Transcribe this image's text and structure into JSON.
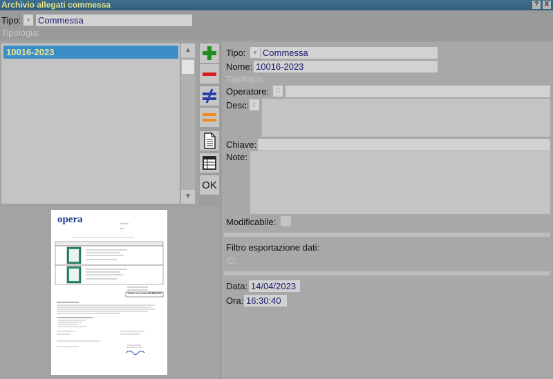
{
  "window": {
    "title": "Archivio allegati commessa",
    "help_label": "?",
    "close_label": "X"
  },
  "header": {
    "tipo_label": "Tipo:",
    "tipo_value": "Commessa",
    "tipologia_label": "Tipologia:"
  },
  "list": {
    "items": [
      {
        "label": "10016-2023",
        "selected": true
      }
    ]
  },
  "toolbar": {
    "add": "plus-icon",
    "remove": "minus-icon",
    "not_equal": "not-equal-icon",
    "equal": "equal-icon",
    "document": "document-icon",
    "table": "table-icon",
    "ok_label": "OK",
    "colors": {
      "add": "#1f8f1f",
      "remove": "#d62020",
      "not_equal": "#2a3fa8",
      "equal": "#f08a1a"
    }
  },
  "detail": {
    "tipo_label": "Tipo:",
    "tipo_value": "Commessa",
    "nome_label": "Nome:",
    "nome_value": "10016-2023",
    "tipologia_label": "Tipologia:",
    "operatore_label": "Operatore:",
    "operatore_btn": "C",
    "desc_label": "Desc:",
    "desc_btn": "F",
    "chiave_label": "Chiave:",
    "note_label": "Note:",
    "modificabile_label": "Modificabile:",
    "filtro_label": "Filtro esportazione dati:",
    "id_label": "ID:",
    "data_label": "Data:",
    "data_value": "14/04/2023",
    "ora_label": "Ora:",
    "ora_value": "16:30:40"
  },
  "preview": {
    "logo_text": "opera",
    "total_label": "Totale iva esclusa",
    "total_value": "€ 5901,97"
  }
}
